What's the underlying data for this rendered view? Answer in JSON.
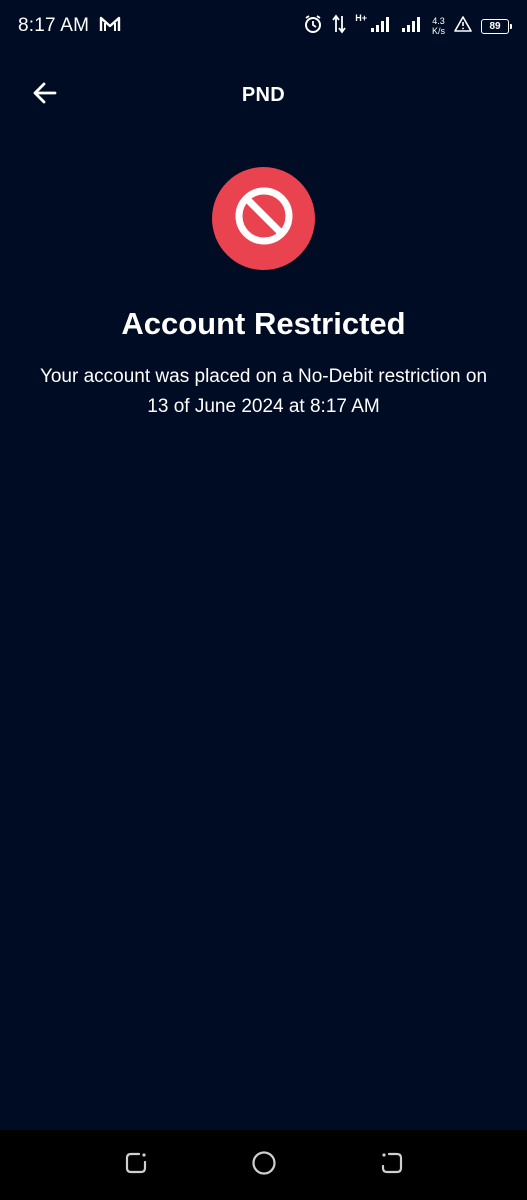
{
  "status_bar": {
    "time": "8:17 AM",
    "notification_icon": "gmail-icon",
    "icons": [
      "alarm-icon",
      "data-transfer-icon",
      "signal-icon",
      "signal-icon-2",
      "warning-icon"
    ],
    "network_type": "H+",
    "speed_value": "4.3",
    "speed_unit": "K/s",
    "battery_level": "89"
  },
  "header": {
    "back_icon": "arrow-left-icon",
    "title": "PND"
  },
  "main": {
    "status_icon": "no-entry-icon",
    "status_icon_color": "#e8434f",
    "headline": "Account Restricted",
    "description": "Your account was placed on a No-Debit restriction on 13 of June 2024 at 8:17 AM"
  },
  "nav_bar": {
    "buttons": [
      "recents-icon",
      "home-icon",
      "back-icon"
    ]
  },
  "colors": {
    "background": "#000c24",
    "accent_red": "#e8434f",
    "text": "#ffffff"
  }
}
